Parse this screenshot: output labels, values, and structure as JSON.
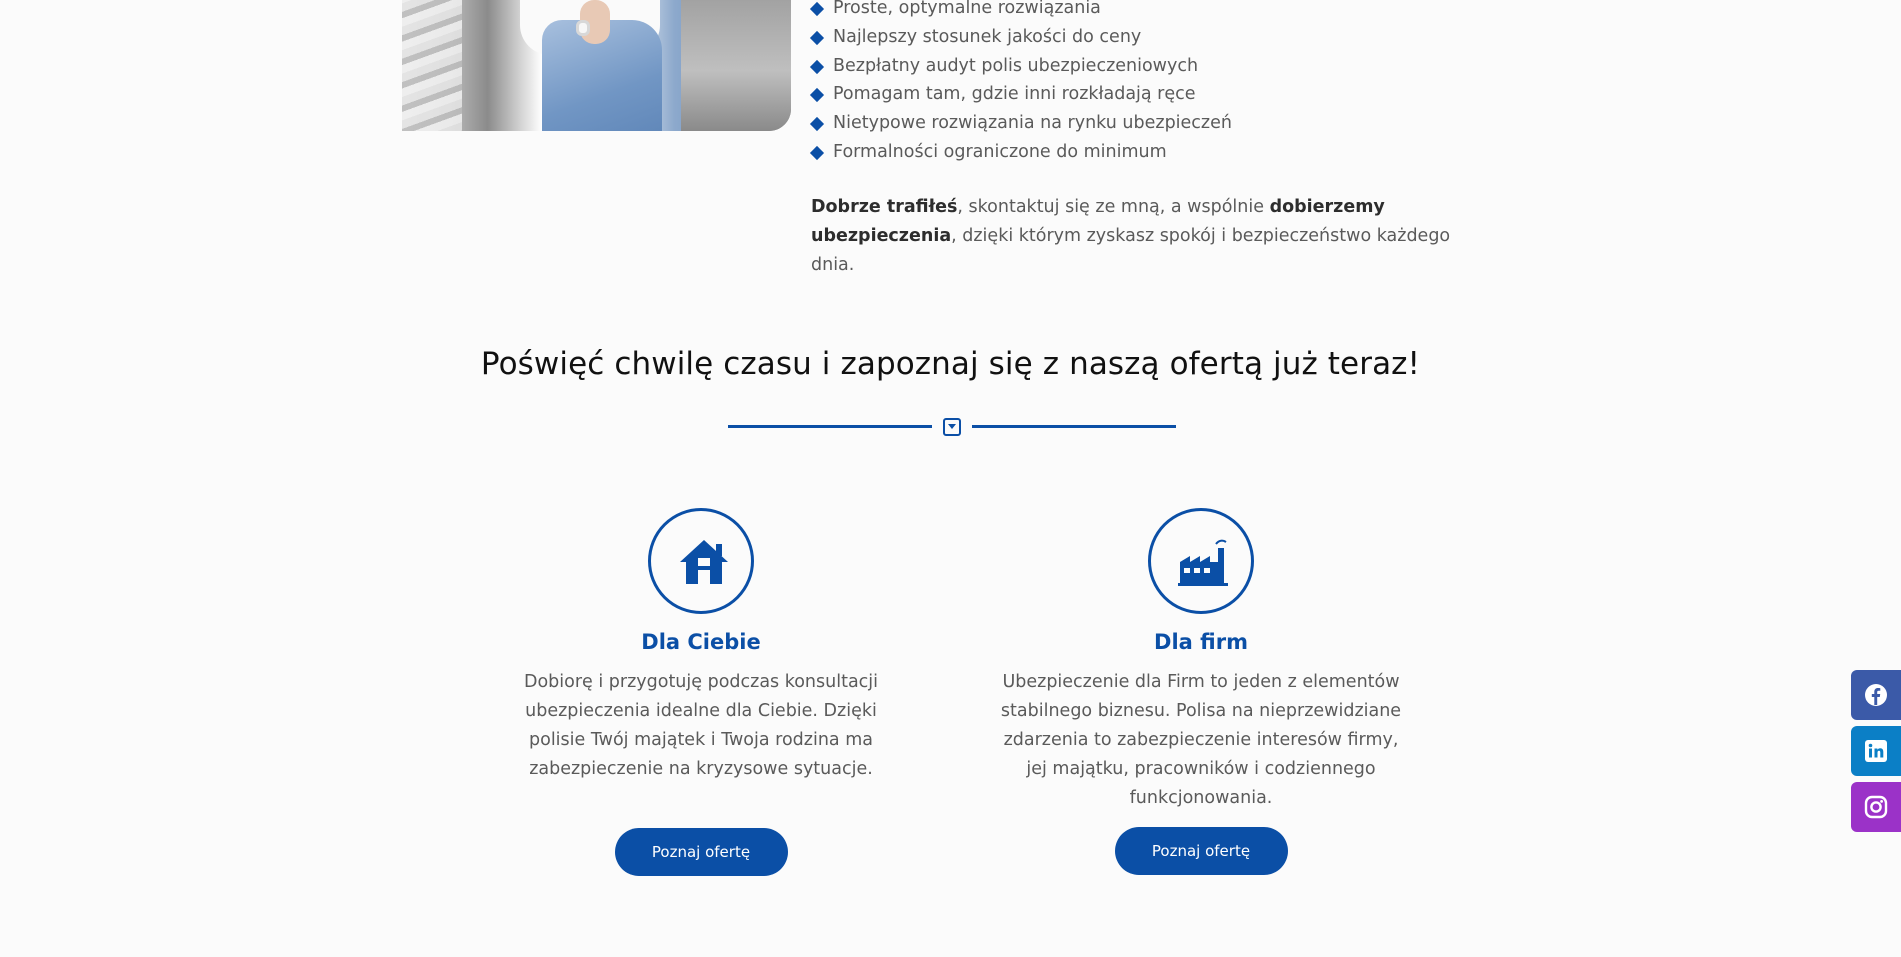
{
  "features": [
    "Proste, optymalne rozwiązania",
    "Najlepszy stosunek jakości do ceny",
    "Bezpłatny audyt polis ubezpieczeniowych",
    "Pomagam tam, gdzie inni rozkładają ręce",
    "Nietypowe rozwiązania na rynku ubezpieczeń",
    "Formalności ograniczone do minimum"
  ],
  "intro": {
    "bold1": "Dobrze trafiłeś",
    "text1": ", skontaktuj się ze mną, a wspólnie ",
    "bold2": "dobierzemy ubezpieczenia",
    "text2": ", dzięki którym zyskasz spokój i bezpieczeństwo każdego dnia."
  },
  "section_title": "Poświęć chwilę czasu i zapoznaj się z naszą ofertą już teraz!",
  "cards": [
    {
      "icon": "house-icon",
      "title": "Dla Ciebie",
      "text": "Dobiorę i przygotuję podczas konsultacji ubezpieczenia idealne dla Ciebie. Dzięki polisie Twój majątek i Twoja rodzina ma zabezpieczenie na kryzysowe sytuacje.",
      "button": "Poznaj ofertę"
    },
    {
      "icon": "factory-icon",
      "title": "Dla firm",
      "text": "Ubezpieczenie dla Firm to jeden z elementów stabilnego biznesu. Polisa na nieprzewidziane zdarzenia to zabezpieczenie interesów firmy, jej majątku, pracowników i codziennego funkcjonowania.",
      "button": "Poznaj ofertę"
    }
  ],
  "social": [
    "facebook-icon",
    "linkedin-icon",
    "instagram-icon"
  ],
  "colors": {
    "accent": "#0b4fa6",
    "facebook": "#3b5aa8",
    "linkedin": "#0b7fc6",
    "instagram": "#9b32c8"
  }
}
